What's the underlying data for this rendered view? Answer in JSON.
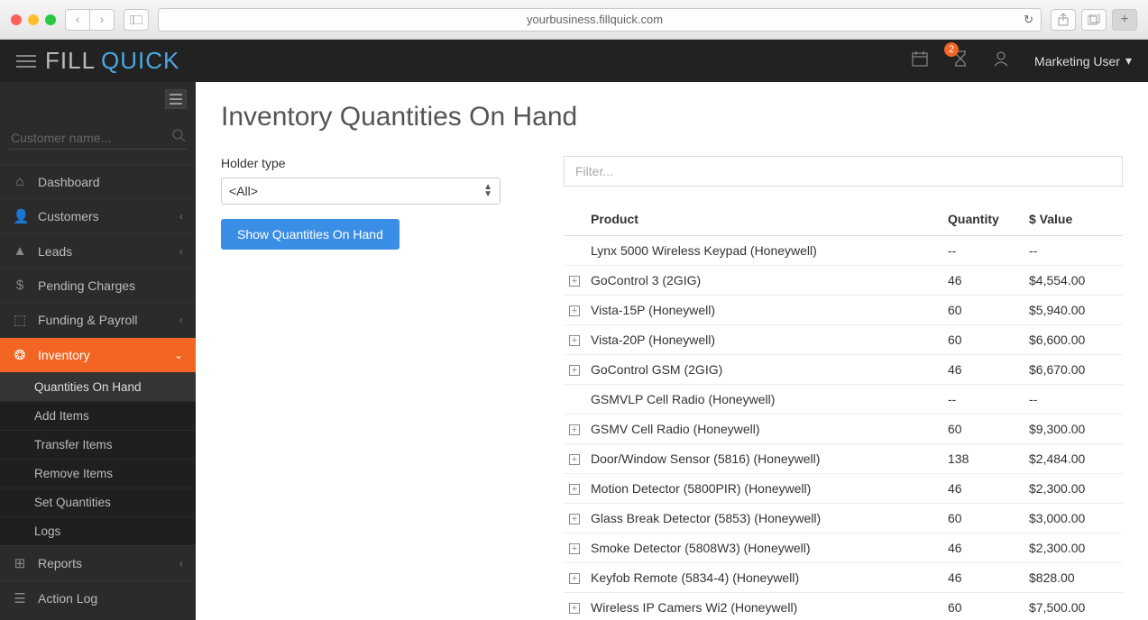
{
  "browser": {
    "url": "yourbusiness.fillquick.com"
  },
  "brand": {
    "part1": "FILL",
    "part2": "QUICK"
  },
  "header": {
    "notification_count": "2",
    "user_label": "Marketing User"
  },
  "sidebar": {
    "search_placeholder": "Customer name...",
    "items": [
      {
        "icon": "home-icon",
        "glyph": "⌂",
        "label": "Dashboard",
        "chev": false
      },
      {
        "icon": "user-icon",
        "glyph": "👤",
        "label": "Customers",
        "chev": true
      },
      {
        "icon": "road-icon",
        "glyph": "▲",
        "label": "Leads",
        "chev": true
      },
      {
        "icon": "dollar-icon",
        "glyph": "$",
        "label": "Pending Charges",
        "chev": false
      },
      {
        "icon": "money-icon",
        "glyph": "⬚",
        "label": "Funding & Payroll",
        "chev": true
      },
      {
        "icon": "cubes-icon",
        "glyph": "❂",
        "label": "Inventory",
        "chev": true,
        "active": true
      },
      {
        "icon": "table-icon",
        "glyph": "⊞",
        "label": "Reports",
        "chev": true
      },
      {
        "icon": "list-icon",
        "glyph": "☰",
        "label": "Action Log",
        "chev": false
      }
    ],
    "inventory_sub": [
      "Quantities On Hand",
      "Add Items",
      "Transfer Items",
      "Remove Items",
      "Set Quantities",
      "Logs"
    ]
  },
  "page": {
    "title": "Inventory Quantities On Hand",
    "holder_label": "Holder type",
    "holder_value": "<All>",
    "show_button": "Show Quantities On Hand",
    "filter_placeholder": "Filter...",
    "columns": {
      "product": "Product",
      "quantity": "Quantity",
      "value": "$ Value"
    },
    "rows": [
      {
        "expand": false,
        "product": "Lynx 5000 Wireless Keypad (Honeywell)",
        "qty": "--",
        "val": "--"
      },
      {
        "expand": true,
        "product": "GoControl 3 (2GIG)",
        "qty": "46",
        "val": "$4,554.00"
      },
      {
        "expand": true,
        "product": "Vista-15P (Honeywell)",
        "qty": "60",
        "val": "$5,940.00"
      },
      {
        "expand": true,
        "product": "Vista-20P (Honeywell)",
        "qty": "60",
        "val": "$6,600.00"
      },
      {
        "expand": true,
        "product": "GoControl GSM (2GIG)",
        "qty": "46",
        "val": "$6,670.00"
      },
      {
        "expand": false,
        "product": "GSMVLP Cell Radio (Honeywell)",
        "qty": "--",
        "val": "--"
      },
      {
        "expand": true,
        "product": "GSMV Cell Radio (Honeywell)",
        "qty": "60",
        "val": "$9,300.00"
      },
      {
        "expand": true,
        "product": "Door/Window Sensor (5816) (Honeywell)",
        "qty": "138",
        "val": "$2,484.00"
      },
      {
        "expand": true,
        "product": "Motion Detector (5800PIR) (Honeywell)",
        "qty": "46",
        "val": "$2,300.00"
      },
      {
        "expand": true,
        "product": "Glass Break Detector (5853) (Honeywell)",
        "qty": "60",
        "val": "$3,000.00"
      },
      {
        "expand": true,
        "product": "Smoke Detector (5808W3) (Honeywell)",
        "qty": "46",
        "val": "$2,300.00"
      },
      {
        "expand": true,
        "product": "Keyfob Remote (5834-4) (Honeywell)",
        "qty": "46",
        "val": "$828.00"
      },
      {
        "expand": true,
        "product": "Wireless IP Camers Wi2 (Honeywell)",
        "qty": "60",
        "val": "$7,500.00"
      }
    ]
  }
}
